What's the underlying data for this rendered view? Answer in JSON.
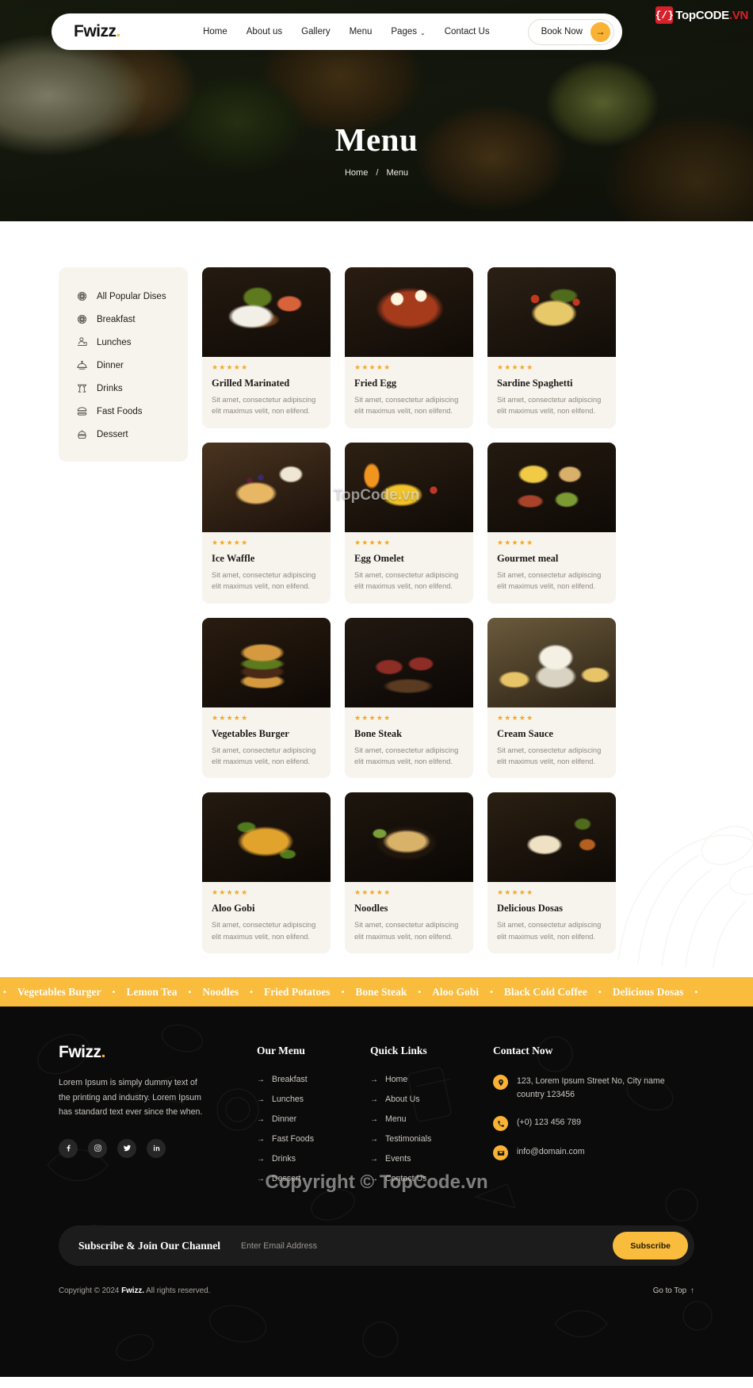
{
  "brand": {
    "name": "Fwizz",
    "dot": "."
  },
  "watermark": {
    "top_badge": "{/}",
    "top_text": "TopCODE",
    "top_tld": ".VN",
    "middle": "TopCode.vn",
    "bottom": "Copyright © TopCode.vn"
  },
  "nav": {
    "links": [
      {
        "label": "Home",
        "caret": ""
      },
      {
        "label": "About us",
        "caret": ""
      },
      {
        "label": "Gallery",
        "caret": ""
      },
      {
        "label": "Menu",
        "caret": ""
      },
      {
        "label": "Pages",
        "caret": "⌄"
      },
      {
        "label": "Contact Us",
        "caret": ""
      }
    ],
    "book_label": "Book Now",
    "book_icon": "→"
  },
  "hero": {
    "title": "Menu",
    "breadcrumb_home": "Home",
    "breadcrumb_sep": "/",
    "breadcrumb_current": "Menu"
  },
  "categories": [
    {
      "label": "All Popular Dises",
      "icon": "noodle-bowl-icon"
    },
    {
      "label": "Breakfast",
      "icon": "noodle-bowl-icon"
    },
    {
      "label": "Lunches",
      "icon": "lunch-tray-icon"
    },
    {
      "label": "Dinner",
      "icon": "cloche-icon"
    },
    {
      "label": "Drinks",
      "icon": "cocktail-icon"
    },
    {
      "label": "Fast Foods",
      "icon": "burger-icon"
    },
    {
      "label": "Dessert",
      "icon": "cupcake-icon"
    }
  ],
  "dishes": [
    {
      "title": "Grilled Marinated",
      "desc": "Sit amet, consectetur adipiscing elit maximus velit, non elifend.",
      "stars": "★★★★★",
      "img": "img-grilled"
    },
    {
      "title": "Fried Egg",
      "desc": "Sit amet, consectetur adipiscing elit maximus velit, non elifend.",
      "stars": "★★★★★",
      "img": "img-friedegg"
    },
    {
      "title": "Sardine Spaghetti",
      "desc": "Sit amet, consectetur adipiscing elit maximus velit, non elifend.",
      "stars": "★★★★★",
      "img": "img-sardine"
    },
    {
      "title": "Ice Waffle",
      "desc": "Sit amet, consectetur adipiscing elit maximus velit, non elifend.",
      "stars": "★★★★★",
      "img": "img-waffle"
    },
    {
      "title": "Egg Omelet",
      "desc": "Sit amet, consectetur adipiscing elit maximus velit, non elifend.",
      "stars": "★★★★★",
      "img": "img-omelet"
    },
    {
      "title": "Gourmet meal",
      "desc": "Sit amet, consectetur adipiscing elit maximus velit, non elifend.",
      "stars": "★★★★★",
      "img": "img-gourmet"
    },
    {
      "title": "Vegetables Burger",
      "desc": "Sit amet, consectetur adipiscing elit maximus velit, non elifend.",
      "stars": "★★★★★",
      "img": "img-burger"
    },
    {
      "title": "Bone Steak",
      "desc": "Sit amet, consectetur adipiscing elit maximus velit, non elifend.",
      "stars": "★★★★★",
      "img": "img-steak"
    },
    {
      "title": "Cream Sauce",
      "desc": "Sit amet, consectetur adipiscing elit maximus velit, non elifend.",
      "stars": "★★★★★",
      "img": "img-cream"
    },
    {
      "title": "Aloo Gobi",
      "desc": "Sit amet, consectetur adipiscing elit maximus velit, non elifend.",
      "stars": "★★★★★",
      "img": "img-aloo"
    },
    {
      "title": "Noodles",
      "desc": "Sit amet, consectetur adipiscing elit maximus velit, non elifend.",
      "stars": "★★★★★",
      "img": "img-noodles"
    },
    {
      "title": "Delicious Dosas",
      "desc": "Sit amet, consectetur adipiscing elit maximus velit, non elifend.",
      "stars": "★★★★★",
      "img": "img-dosa"
    }
  ],
  "marquee": {
    "separator": "•",
    "items": [
      "Vegetables Burger",
      "Lemon Tea",
      "Noodles",
      "Fried Potatoes",
      "Bone Steak",
      "Aloo Gobi",
      "Black Cold Coffee",
      "Delicious Dosas"
    ]
  },
  "footer": {
    "description": "Lorem Ipsum is simply dummy text of the printing and industry. Lorem Ipsum has standard text ever since the when.",
    "socials": [
      {
        "name": "facebook-icon"
      },
      {
        "name": "instagram-icon"
      },
      {
        "name": "twitter-icon"
      },
      {
        "name": "linkedin-icon"
      }
    ],
    "menu_heading": "Our Menu",
    "menu_links": [
      "Breakfast",
      "Lunches",
      "Dinner",
      "Fast Foods",
      "Drinks",
      "Dessert"
    ],
    "quick_heading": "Quick Links",
    "quick_links": [
      "Home",
      "About Us",
      "Menu",
      "Testimonials",
      "Events",
      "Contact Us"
    ],
    "contact_heading": "Contact Now",
    "contact": [
      {
        "icon": "location-pin-icon",
        "text": "123, Lorem Ipsum Street No, City name country 123456"
      },
      {
        "icon": "phone-icon",
        "text": "(+0) 123 456 789"
      },
      {
        "icon": "envelope-icon",
        "text": "info@domain.com"
      }
    ],
    "arrow": "→",
    "subscribe_label": "Subscribe & Join Our Channel",
    "subscribe_placeholder": "Enter Email Address",
    "subscribe_button": "Subscribe",
    "copyright_prefix": "Copyright © 2024",
    "copyright_brand": "Fwizz.",
    "copyright_suffix": "All rights reserved.",
    "go_to_top": "Go to Top",
    "go_to_top_icon": "↑"
  },
  "colors": {
    "accent": "#f9b233",
    "marquee_bg": "#f9bc3c",
    "card_bg": "#f7f4ee",
    "footer_bg": "#0b0b0b",
    "star": "#f1a92a"
  }
}
